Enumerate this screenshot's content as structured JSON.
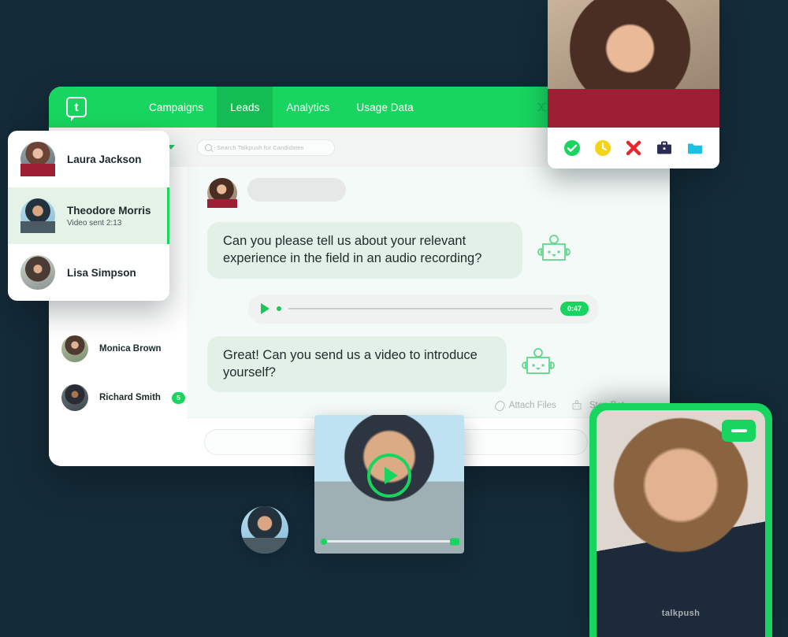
{
  "colors": {
    "background": "#142b38",
    "brand_green": "#18D55F",
    "nav_active_green": "#14BC54",
    "bubble_green": "#e2f0e7",
    "panel_white": "#ffffff",
    "status_yellow": "#F5D316",
    "status_red": "#E8252A",
    "briefcase_navy": "#2B2B53",
    "folder_cyan": "#18C3E0"
  },
  "app": {
    "logo_letter": "t",
    "nav": {
      "items": [
        {
          "label": "Campaigns",
          "active": false
        },
        {
          "label": "Leads",
          "active": true
        },
        {
          "label": "Analytics",
          "active": false
        },
        {
          "label": "Usage Data",
          "active": false
        }
      ],
      "right_icons": [
        "shuffle-icon",
        "chat-square-icon"
      ]
    },
    "subbar": {
      "dropdown_icon": "chevron-down-icon",
      "search": {
        "placeholder": "Search Talkpush for Candidates",
        "value": "",
        "icon": "search-icon"
      }
    }
  },
  "contact_card": {
    "rows": [
      {
        "name": "Laura Jackson",
        "subtitle": "",
        "selected": false,
        "avatar": "ph-laura"
      },
      {
        "name": "Theodore Morris",
        "subtitle": "Video sent 2:13",
        "selected": true,
        "avatar": "ph-theo"
      },
      {
        "name": "Lisa Simpson",
        "subtitle": "",
        "selected": false,
        "avatar": "ph-lisa"
      }
    ]
  },
  "side_rail": {
    "rows": [
      {
        "name": "Monica Brown",
        "badge": "",
        "avatar": "ph-monica"
      },
      {
        "name": "Richard Smith",
        "badge": "5",
        "avatar": "ph-richard"
      }
    ]
  },
  "chat": {
    "placeholder_bubble": "",
    "messages": [
      {
        "type": "text",
        "text": "Can you please tell us about your relevant experience in the field in an audio recording?",
        "bot_icon": "robot-icon"
      },
      {
        "type": "audio",
        "duration": "0:47",
        "play_icon": "play-icon"
      },
      {
        "type": "text",
        "text": "Great! Can you send us a video to introduce yourself?",
        "bot_icon": "robot-icon"
      }
    ],
    "tools": {
      "attach_label": "Attach Files",
      "attach_icon": "paperclip-icon",
      "stop_bot_label": "Stop Bot",
      "stop_bot_icon": "robot-icon"
    },
    "composer": {
      "input_value": "",
      "input_placeholder": "",
      "send_icon": "send-icon",
      "email_icon": "email-icon"
    }
  },
  "video_card": {
    "photo": "ph-woman",
    "actions": [
      {
        "name": "approve",
        "icon": "check-circle-icon",
        "color": "#18D55F"
      },
      {
        "name": "pending",
        "icon": "clock-icon",
        "color": "#F5D316"
      },
      {
        "name": "reject",
        "icon": "cross-icon",
        "color": "#E8252A"
      },
      {
        "name": "hire",
        "icon": "briefcase-icon",
        "color": "#2B2B53"
      },
      {
        "name": "archive",
        "icon": "folder-icon",
        "color": "#18C3E0"
      }
    ]
  },
  "video_thumb": {
    "photo": "ph-guy",
    "play_icon": "play-circle-icon",
    "progress_percent": 0
  },
  "mini_avatar": {
    "photo": "ph-theo"
  },
  "phone_panel": {
    "photo": "ph-man",
    "minimize_icon": "minimize-icon",
    "watermark": "talkpush"
  }
}
